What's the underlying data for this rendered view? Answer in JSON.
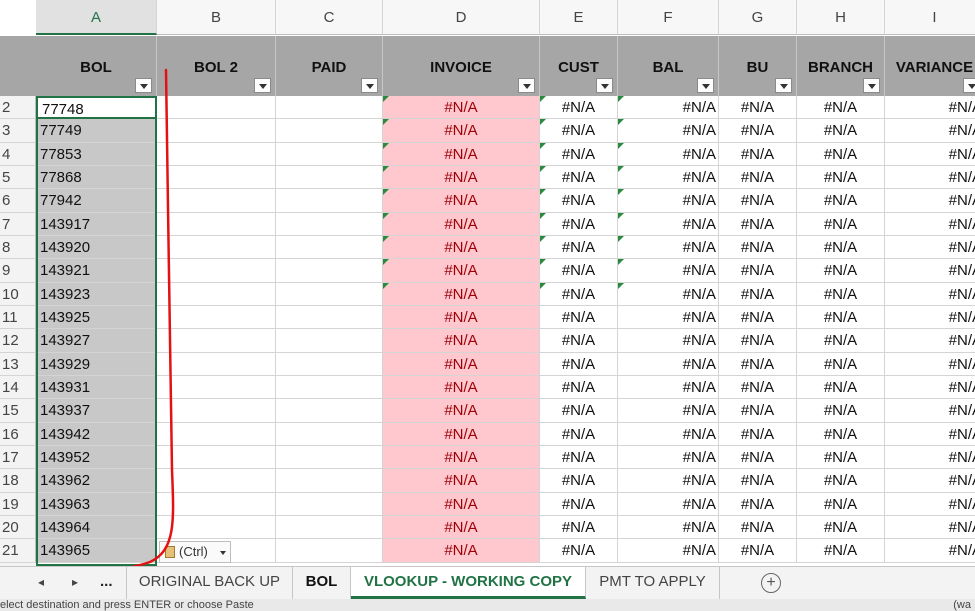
{
  "column_letters": [
    "A",
    "B",
    "C",
    "D",
    "E",
    "F",
    "G",
    "H",
    "I"
  ],
  "headers": [
    "BOL",
    "BOL 2",
    "PAID",
    "INVOICE",
    "CUST",
    "BAL",
    "BU",
    "BRANCH",
    "VARIANCE"
  ],
  "row_numbers": [
    "2",
    "3",
    "4",
    "5",
    "6",
    "7",
    "8",
    "9",
    "10",
    "11",
    "12",
    "13",
    "14",
    "15",
    "16",
    "17",
    "18",
    "19",
    "20",
    "21"
  ],
  "rows": [
    {
      "bol": "77748"
    },
    {
      "bol": "77749"
    },
    {
      "bol": "77853"
    },
    {
      "bol": "77868"
    },
    {
      "bol": "77942"
    },
    {
      "bol": "143917"
    },
    {
      "bol": "143920"
    },
    {
      "bol": "143921"
    },
    {
      "bol": "143923"
    },
    {
      "bol": "143925"
    },
    {
      "bol": "143927"
    },
    {
      "bol": "143929"
    },
    {
      "bol": "143931"
    },
    {
      "bol": "143937"
    },
    {
      "bol": "143942"
    },
    {
      "bol": "143952"
    },
    {
      "bol": "143962"
    },
    {
      "bol": "143963"
    },
    {
      "bol": "143964"
    },
    {
      "bol": "143965"
    }
  ],
  "na_value": "#N/A",
  "paste_options_label": "(Ctrl)",
  "sheet_nav": {
    "prev": "◂",
    "next": "▸",
    "more": "..."
  },
  "tabs": [
    {
      "label": "ORIGINAL BACK UP"
    },
    {
      "label": "BOL"
    },
    {
      "label": "VLOOKUP - WORKING COPY"
    },
    {
      "label": "PMT TO APPLY"
    }
  ],
  "add_sheet_label": "+",
  "status_text": "elect destination and press ENTER or choose Paste",
  "status_right": "(wa",
  "colors": {
    "accent": "#217346",
    "header_bg": "#a6a6a6",
    "invoice_bg": "#ffc7ce",
    "invoice_text": "#9c0006",
    "annotation": "#e31212"
  }
}
